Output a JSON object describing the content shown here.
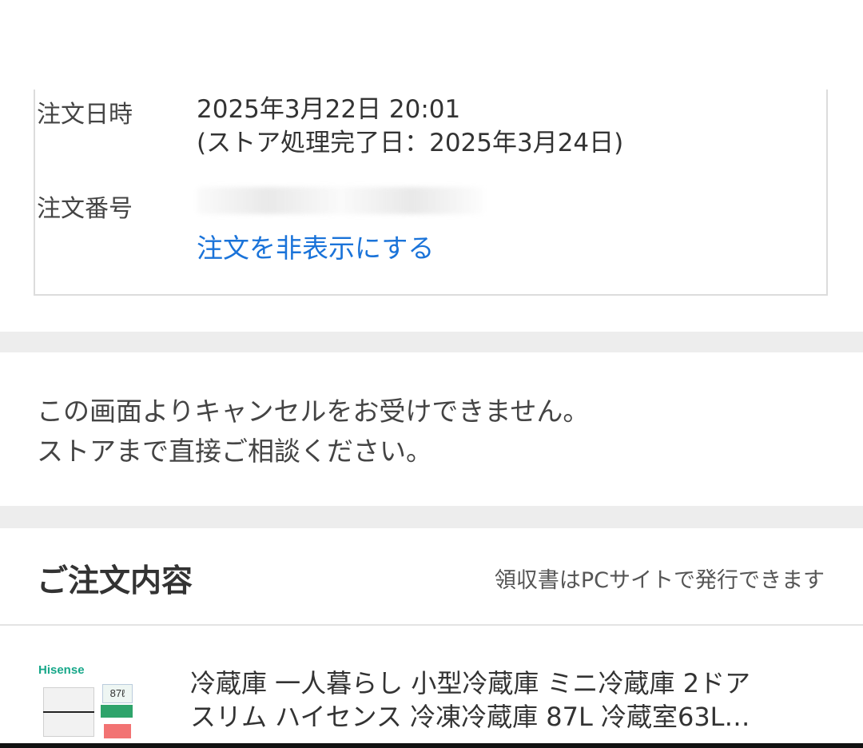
{
  "order_info": {
    "date_label": "注文日時",
    "date_value": "2025年3月22日 20:01",
    "store_completed": "(ストア処理完了日：2025年3月24日)",
    "number_label": "注文番号",
    "hide_link": "注文を非表示にする"
  },
  "notice": {
    "line1": "この画面よりキャンセルをお受けできません。",
    "line2": "ストアまで直接ご相談ください。"
  },
  "order_contents": {
    "title": "ご注文内容",
    "receipt_note": "領収書はPCサイトで発行できます"
  },
  "product": {
    "brand": "Hisense",
    "capacity_badge": "87ℓ",
    "title_line1": "冷蔵庫 一人暮らし 小型冷蔵庫 ミニ冷蔵庫 2ドア",
    "title_line2": "スリム ハイセンス 冷凍冷蔵庫 87L 冷蔵室63L…"
  },
  "colors": {
    "link": "#1a73d9",
    "brand_green": "#18a88a",
    "separator_band": "#ededed"
  }
}
